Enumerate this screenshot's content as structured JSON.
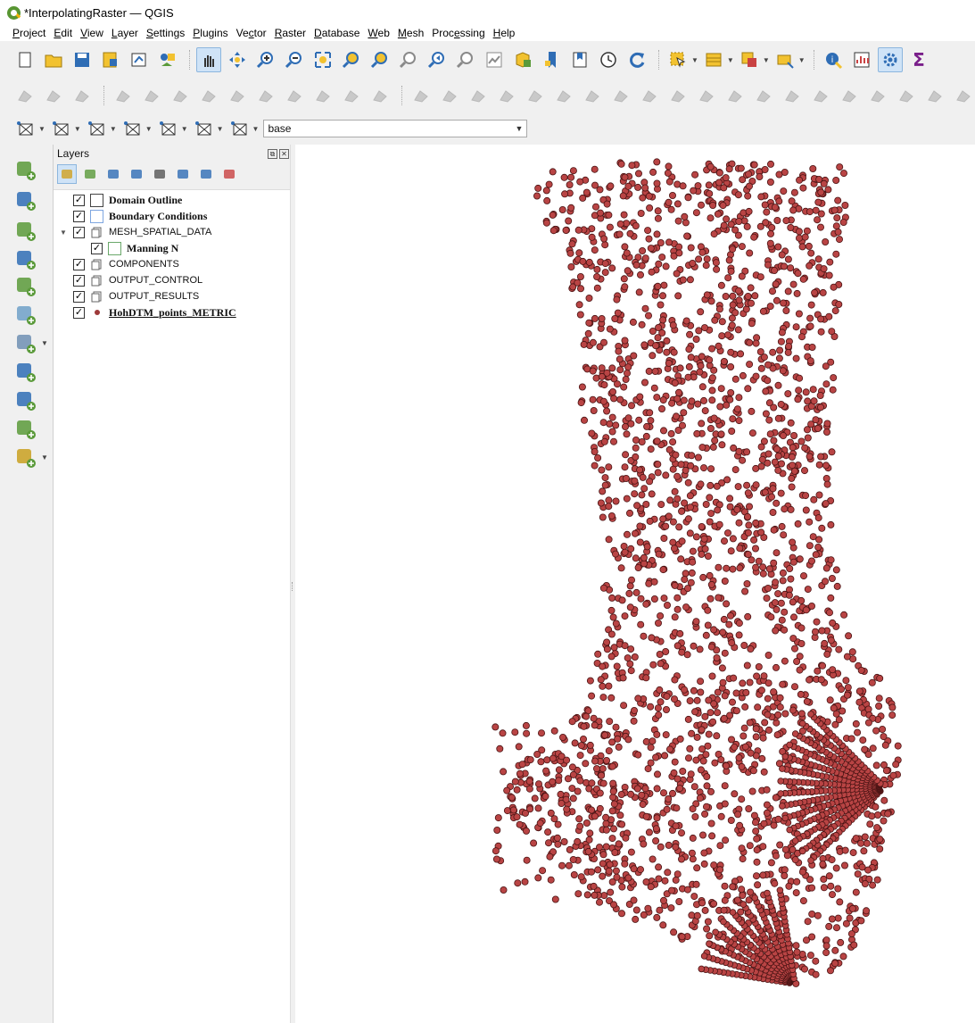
{
  "window": {
    "title": "*InterpolatingRaster — QGIS"
  },
  "menubar": {
    "items": [
      {
        "label": "Project",
        "u": 0
      },
      {
        "label": "Edit",
        "u": 0
      },
      {
        "label": "View",
        "u": 0
      },
      {
        "label": "Layer",
        "u": 0
      },
      {
        "label": "Settings",
        "u": 0
      },
      {
        "label": "Plugins",
        "u": 0
      },
      {
        "label": "Vector",
        "u": 2
      },
      {
        "label": "Raster",
        "u": 0
      },
      {
        "label": "Database",
        "u": 0
      },
      {
        "label": "Web",
        "u": 0
      },
      {
        "label": "Mesh",
        "u": 0
      },
      {
        "label": "Processing",
        "u": 4
      },
      {
        "label": "Help",
        "u": 0
      }
    ]
  },
  "toolbar3": {
    "combo_value": "base"
  },
  "layers_panel": {
    "title": "Layers",
    "layers": [
      {
        "name": "Domain Outline",
        "checked": true,
        "symbol": "poly-plain",
        "bold": true,
        "indent": 0,
        "expander": ""
      },
      {
        "name": "Boundary Conditions",
        "checked": true,
        "symbol": "poly-blue",
        "bold": true,
        "indent": 0,
        "expander": ""
      },
      {
        "name": "MESH_SPATIAL_DATA",
        "checked": true,
        "symbol": "group",
        "bold": false,
        "indent": 0,
        "expander": "▼"
      },
      {
        "name": "Manning N",
        "checked": true,
        "symbol": "poly-green",
        "bold": true,
        "indent": 1,
        "expander": ""
      },
      {
        "name": "COMPONENTS",
        "checked": true,
        "symbol": "group",
        "bold": false,
        "indent": 0,
        "expander": ""
      },
      {
        "name": "OUTPUT_CONTROL",
        "checked": true,
        "symbol": "group",
        "bold": false,
        "indent": 0,
        "expander": ""
      },
      {
        "name": "OUTPUT_RESULTS",
        "checked": true,
        "symbol": "group",
        "bold": false,
        "indent": 0,
        "expander": ""
      },
      {
        "name": "HohDTM_points_METRIC",
        "checked": true,
        "symbol": "point",
        "bold": true,
        "underline": true,
        "indent": 0,
        "expander": ""
      }
    ]
  },
  "map": {
    "point_fill": "#b94444",
    "point_stroke": "#4a1414",
    "background": "#ffffff"
  },
  "icons": {
    "toolbar1": [
      "new-project-icon",
      "open-project-icon",
      "save-project-icon",
      "save-as-icon",
      "print-layout-icon",
      "style-manager-icon",
      "pan-icon",
      "pan-to-selection-icon",
      "zoom-in-icon",
      "zoom-out-icon",
      "zoom-full-icon",
      "zoom-to-selection-icon",
      "zoom-to-layer-icon",
      "zoom-native-icon",
      "zoom-last-icon",
      "zoom-next-icon",
      "new-map-view-icon",
      "new-3d-view-icon",
      "bookmark-icon",
      "show-bookmarks-icon",
      "temporal-controller-icon",
      "refresh-icon",
      "select-features-icon",
      "attribute-table-icon",
      "select-by-value-icon",
      "deselect-icon",
      "identify-icon",
      "statistics-icon",
      "processing-toolbox-icon",
      "sum-icon"
    ],
    "left": [
      "add-vector-layer-icon",
      "add-raster-layer-icon",
      "add-mesh-layer-icon",
      "add-delimited-text-icon",
      "add-geopackage-icon",
      "add-spatialite-icon",
      "add-postgis-icon",
      "add-wms-icon",
      "add-wfs-icon",
      "add-wcs-icon",
      "new-shapefile-icon"
    ]
  }
}
